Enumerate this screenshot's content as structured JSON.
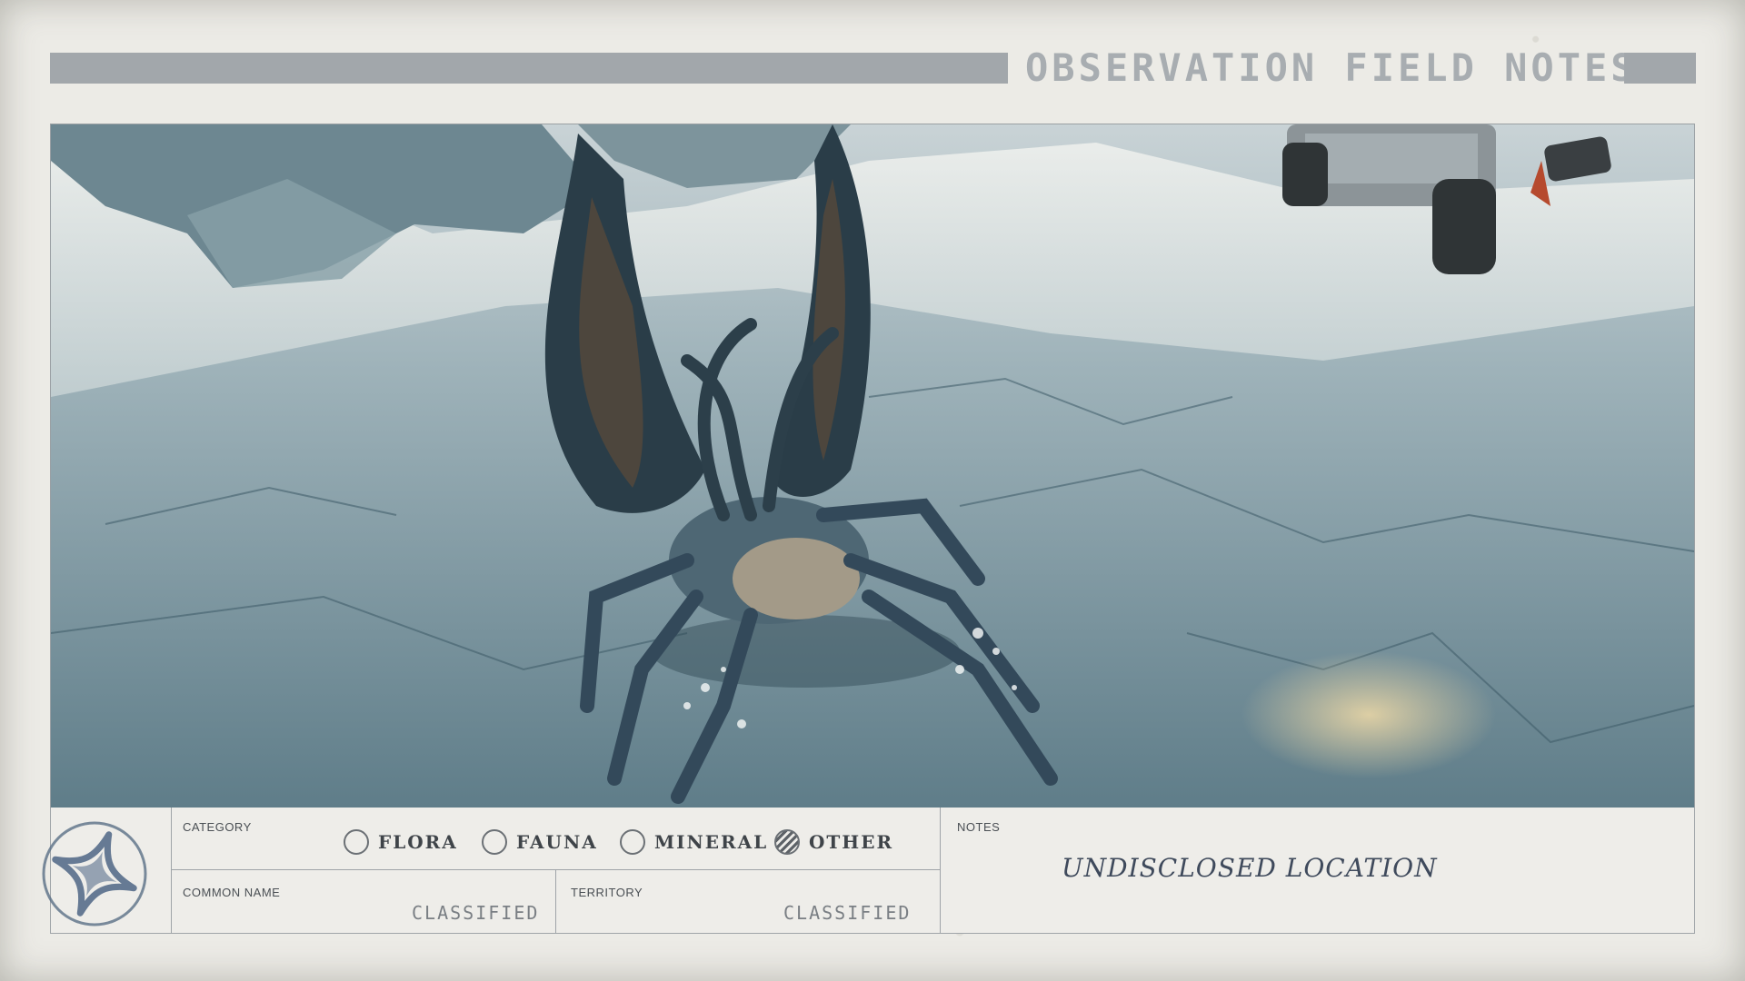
{
  "header": {
    "title": "OBSERVATION FIELD NOTES"
  },
  "photo": {
    "subject_icon": "alien-creature",
    "background_icon": "rover-vehicle"
  },
  "form": {
    "category_label": "CATEGORY",
    "options": [
      {
        "label": "FLORA",
        "selected": false
      },
      {
        "label": "FAUNA",
        "selected": false
      },
      {
        "label": "MINERAL",
        "selected": false
      },
      {
        "label": "OTHER",
        "selected": true
      }
    ],
    "common_name_label": "COMMON NAME",
    "common_name_value": "CLASSIFIED",
    "territory_label": "TERRITORY",
    "territory_value": "CLASSIFIED",
    "notes_label": "NOTES",
    "notes_value": "UNDISCLOSED LOCATION",
    "emblem_icon": "star-emblem-icon"
  },
  "colors": {
    "paper": "#ecebe6",
    "bar": "#a2a7ab",
    "ink": "#3f4a5c"
  }
}
